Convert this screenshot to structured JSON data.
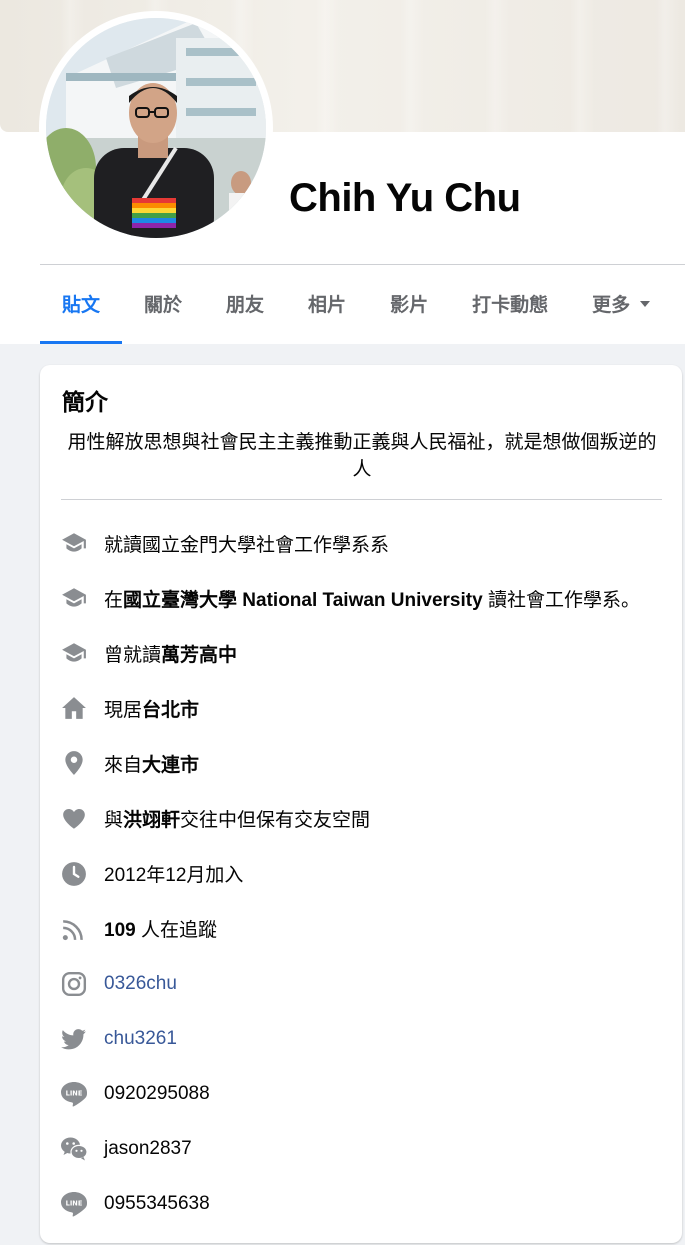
{
  "profile": {
    "name": "Chih Yu Chu"
  },
  "tabs": [
    {
      "label": "貼文",
      "active": true
    },
    {
      "label": "關於",
      "active": false
    },
    {
      "label": "朋友",
      "active": false
    },
    {
      "label": "相片",
      "active": false
    },
    {
      "label": "影片",
      "active": false
    },
    {
      "label": "打卡動態",
      "active": false
    },
    {
      "label": "更多",
      "active": false
    }
  ],
  "intro": {
    "title": "簡介",
    "bio": "用性解放思想與社會民主主義推動正義與人民福祉，就是想做個叛逆的人",
    "items": [
      {
        "icon": "graduation-cap-icon",
        "parts": [
          {
            "t": "就讀國立金門大學社會工作學系系",
            "b": false
          }
        ]
      },
      {
        "icon": "graduation-cap-icon",
        "parts": [
          {
            "t": "在",
            "b": false
          },
          {
            "t": "國立臺灣大學 National Taiwan University",
            "b": true
          },
          {
            "t": " 讀社會工作學系。",
            "b": false
          }
        ]
      },
      {
        "icon": "graduation-cap-icon",
        "parts": [
          {
            "t": "曾就讀",
            "b": false
          },
          {
            "t": "萬芳高中",
            "b": true
          }
        ]
      },
      {
        "icon": "home-icon",
        "parts": [
          {
            "t": "現居",
            "b": false
          },
          {
            "t": "台北市",
            "b": true
          }
        ]
      },
      {
        "icon": "location-pin-icon",
        "parts": [
          {
            "t": "來自",
            "b": false
          },
          {
            "t": "大連市",
            "b": true
          }
        ]
      },
      {
        "icon": "heart-icon",
        "parts": [
          {
            "t": "與",
            "b": false
          },
          {
            "t": "洪翊軒",
            "b": true
          },
          {
            "t": "交往中但保有交友空間",
            "b": false
          }
        ]
      },
      {
        "icon": "clock-icon",
        "parts": [
          {
            "t": "2012年12月加入",
            "b": false
          }
        ]
      },
      {
        "icon": "rss-icon",
        "parts": [
          {
            "t": "109",
            "b": true
          },
          {
            "t": " 人在追蹤",
            "b": false
          }
        ]
      },
      {
        "icon": "instagram-icon",
        "parts": [
          {
            "t": "0326chu",
            "b": false,
            "link": true
          }
        ]
      },
      {
        "icon": "twitter-icon",
        "parts": [
          {
            "t": "chu3261",
            "b": false,
            "link": true
          }
        ]
      },
      {
        "icon": "line-icon",
        "parts": [
          {
            "t": "0920295088",
            "b": false
          }
        ]
      },
      {
        "icon": "wechat-icon",
        "parts": [
          {
            "t": "jason2837",
            "b": false
          }
        ]
      },
      {
        "icon": "line-icon",
        "parts": [
          {
            "t": "0955345638",
            "b": false
          }
        ]
      }
    ]
  },
  "colors": {
    "accent": "#1877f2",
    "link": "#385898",
    "icon": "#8a8d91",
    "muted": "#65676b",
    "background": "#f0f2f5"
  }
}
